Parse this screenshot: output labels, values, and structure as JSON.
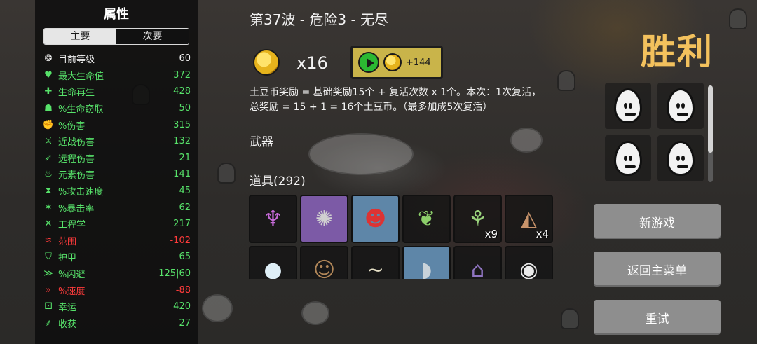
{
  "stats_panel": {
    "title": "属性",
    "tabs": [
      {
        "label": "主要",
        "active": true
      },
      {
        "label": "次要",
        "active": false
      }
    ],
    "rows": [
      {
        "icon": "brain-icon",
        "glyph": "❂",
        "label": "目前等级",
        "value": "60",
        "label_color": "white",
        "value_color": "white"
      },
      {
        "icon": "heart-icon",
        "glyph": "♥",
        "label": "最大生命值",
        "value": "372",
        "label_color": "green",
        "value_color": "green"
      },
      {
        "icon": "regen-heart-icon",
        "glyph": "✚",
        "label": "生命再生",
        "value": "428",
        "label_color": "green",
        "value_color": "green"
      },
      {
        "icon": "vampire-teeth-icon",
        "glyph": "☗",
        "label": "%生命窃取",
        "value": "50",
        "label_color": "green",
        "value_color": "green"
      },
      {
        "icon": "fist-icon",
        "glyph": "✊",
        "label": "%伤害",
        "value": "315",
        "label_color": "green",
        "value_color": "green"
      },
      {
        "icon": "sword-icon",
        "glyph": "⚔",
        "label": "近战伤害",
        "value": "132",
        "label_color": "green",
        "value_color": "green"
      },
      {
        "icon": "bow-icon",
        "glyph": "➶",
        "label": "远程伤害",
        "value": "21",
        "label_color": "green",
        "value_color": "green"
      },
      {
        "icon": "flame-icon",
        "glyph": "♨",
        "label": "元素伤害",
        "value": "141",
        "label_color": "green",
        "value_color": "green"
      },
      {
        "icon": "hourglass-icon",
        "glyph": "⧗",
        "label": "%攻击速度",
        "value": "45",
        "label_color": "green",
        "value_color": "green"
      },
      {
        "icon": "crit-icon",
        "glyph": "✶",
        "label": "%暴击率",
        "value": "62",
        "label_color": "green",
        "value_color": "green"
      },
      {
        "icon": "wrench-icon",
        "glyph": "✕",
        "label": "工程学",
        "value": "217",
        "label_color": "green",
        "value_color": "green"
      },
      {
        "icon": "range-icon",
        "glyph": "≋",
        "label": "范围",
        "value": "-102",
        "label_color": "red",
        "value_color": "red"
      },
      {
        "icon": "shield-icon",
        "glyph": "⛉",
        "label": "护甲",
        "value": "65",
        "label_color": "green",
        "value_color": "green"
      },
      {
        "icon": "dodge-icon",
        "glyph": "≫",
        "label": "%闪避",
        "value": "125|60",
        "label_color": "green",
        "value_color": "green"
      },
      {
        "icon": "speed-icon",
        "glyph": "»",
        "label": "%速度",
        "value": "-88",
        "label_color": "red",
        "value_color": "red"
      },
      {
        "icon": "dice-icon",
        "glyph": "⚀",
        "label": "幸运",
        "value": "420",
        "label_color": "green",
        "value_color": "green"
      },
      {
        "icon": "harvest-icon",
        "glyph": "⸙",
        "label": "收获",
        "value": "27",
        "label_color": "green",
        "value_color": "green"
      }
    ]
  },
  "header": {
    "wave_title": "第37波 - 危险3 - 无尽"
  },
  "reward": {
    "coin_icon": "potato-coin-icon",
    "count": "x16",
    "bonus_button": {
      "play_icon": "play-icon",
      "coin_icon": "potato-coin-icon",
      "label": "+144"
    },
    "description_line1": "土豆币奖励 = 基础奖励15个 + 复活次数 x 1个。本次：1次复活，",
    "description_line2": "总奖励 = 15 + 1 = 16个土豆币。（最多加成5次复活）"
  },
  "weapons": {
    "label": "武器"
  },
  "items": {
    "label": "道具(292)",
    "cells": [
      {
        "name": "item-purple-altar",
        "glyph": "♆",
        "count": "",
        "style": "plain"
      },
      {
        "name": "item-spiked-ball",
        "glyph": "✺",
        "count": "",
        "style": "rare"
      },
      {
        "name": "item-clown-face",
        "glyph": "☻",
        "count": "",
        "style": "blue"
      },
      {
        "name": "item-green-sack",
        "glyph": "❦",
        "count": "",
        "style": "plain"
      },
      {
        "name": "item-sprout",
        "glyph": "⚘",
        "count": "x9",
        "style": "plain"
      },
      {
        "name": "item-cake-slice",
        "glyph": "◭",
        "count": "x4",
        "style": "plain"
      },
      {
        "name": "item-snowball",
        "glyph": "●",
        "count": "",
        "style": "plain"
      },
      {
        "name": "item-monkey",
        "glyph": "☺",
        "count": "",
        "style": "plain"
      },
      {
        "name": "item-lizard",
        "glyph": "∼",
        "count": "",
        "style": "plain"
      },
      {
        "name": "item-horn",
        "glyph": "◗",
        "count": "",
        "style": "blue"
      },
      {
        "name": "item-witch-hat",
        "glyph": "⌂",
        "count": "",
        "style": "plain"
      },
      {
        "name": "item-bandaged-head",
        "glyph": "◉",
        "count": "",
        "style": "plain"
      }
    ]
  },
  "result": {
    "title": "胜利",
    "title_color": "#f3c15d"
  },
  "characters": [
    {
      "name": "character-angry-egg"
    },
    {
      "name": "character-glasses-egg"
    },
    {
      "name": "character-hat-egg"
    },
    {
      "name": "character-vampire-egg"
    }
  ],
  "menu": {
    "new_game": "新游戏",
    "main_menu": "返回主菜单",
    "retry": "重试"
  },
  "colors": {
    "green": "#57e26a",
    "red": "#ff3b3b",
    "button": "#8e8e8e",
    "bonus_button": "#c9b44a"
  }
}
